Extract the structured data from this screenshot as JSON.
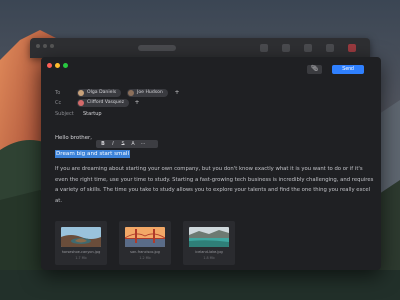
{
  "window": {
    "attach_icon": "paperclip-icon",
    "send_label": "Send"
  },
  "to": {
    "label": "To",
    "recipients": [
      {
        "name": "Olga Daniels",
        "avatar_color": "#c8a27a"
      },
      {
        "name": "Joe Hudson",
        "avatar_color": "#8b6f5a"
      }
    ],
    "add": "+"
  },
  "cc": {
    "label": "Cc",
    "recipients": [
      {
        "name": "Clifford Vasquez",
        "avatar_color": "#d46a6a"
      }
    ],
    "add": "+"
  },
  "subject": {
    "label": "Subject",
    "value": "Startup"
  },
  "body": {
    "greeting": "Hello brother,",
    "highlighted": "Dream big and start small",
    "paragraph": "If you are dreaming about starting your own company, but you don't know exactly what it is you want to do or if it's even the right time, use your time to study. Starting a fast-growing tech business is incredibly challenging, and requires a variety of skills. The time you take to study allows you to explore your talents and find the one thing you really excel at."
  },
  "format_toolbar": {
    "bold": "B",
    "italic": "I",
    "strike": "S",
    "font": "A",
    "more": "···"
  },
  "attachments": [
    {
      "name": "horseshoe-canyon.jpg",
      "size": "1.7 Mb"
    },
    {
      "name": "san-francisco.jpg",
      "size": "1.2 Mb"
    },
    {
      "name": "iceland-lake.jpg",
      "size": "1.8 Mb"
    }
  ],
  "colors": {
    "accent": "#2f80ff",
    "selection": "#3c82d8",
    "window_bg": "#1f2023"
  }
}
